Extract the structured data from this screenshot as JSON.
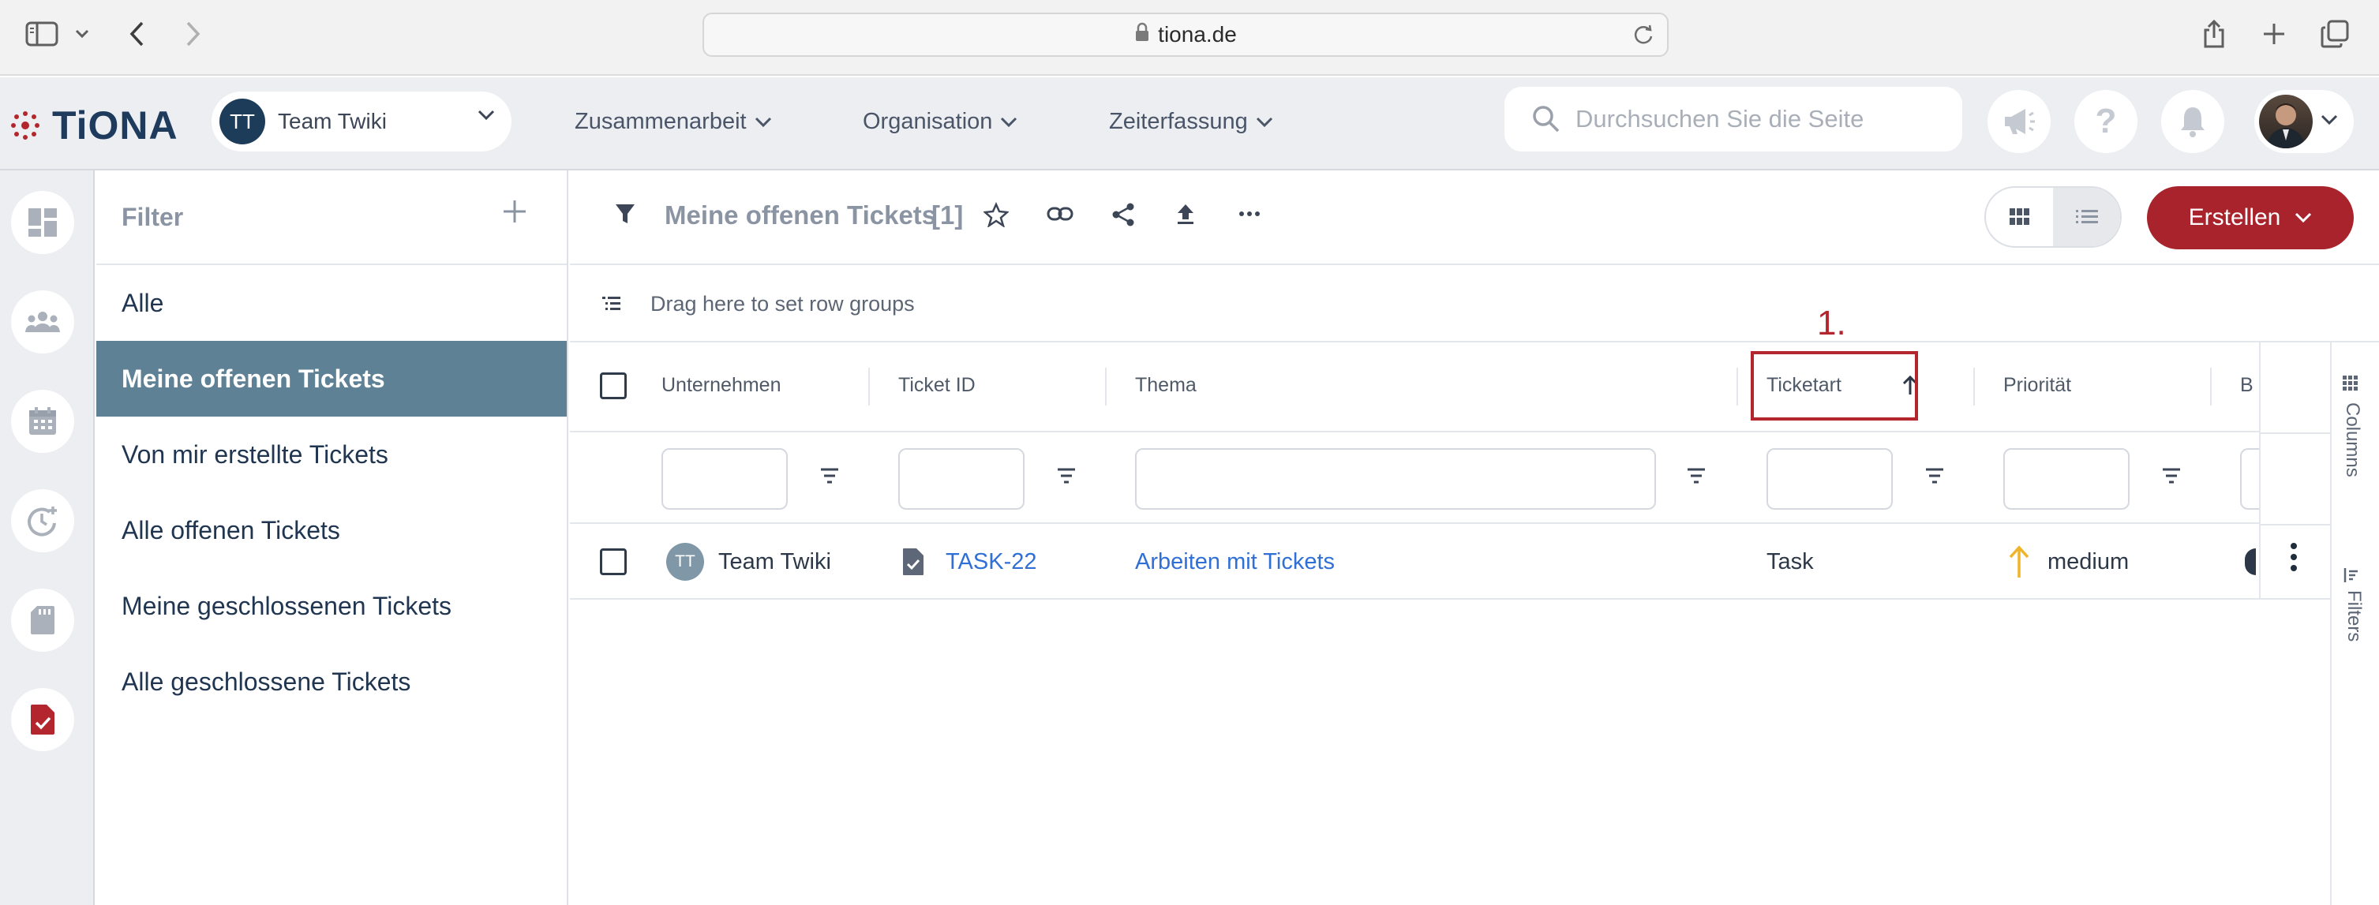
{
  "browser": {
    "url": "tiona.de"
  },
  "header": {
    "logo_text": "TiONA",
    "team": {
      "initials": "TT",
      "name": "Team Twiki"
    },
    "nav": [
      "Zusammenarbeit",
      "Organisation",
      "Zeiterfassung"
    ],
    "search_placeholder": "Durchsuchen Sie die Seite"
  },
  "filter_panel": {
    "title": "Filter",
    "items": [
      "Alle",
      "Meine offenen Tickets",
      "Von mir erstellte Tickets",
      "Alle offenen Tickets",
      "Meine geschlossenen Tickets",
      "Alle geschlossene Tickets"
    ],
    "active_index": 1
  },
  "toolbar": {
    "view_title": "Meine offenen Tickets",
    "count": "[1]",
    "create_label": "Erstellen"
  },
  "grid": {
    "group_hint": "Drag here to set row groups",
    "columns": [
      "Unternehmen",
      "Ticket ID",
      "Thema",
      "Ticketart",
      "Priorität",
      "B"
    ],
    "sorted_column": "Ticketart",
    "sort_direction": "ascending",
    "rows": [
      {
        "company_initials": "TT",
        "company": "Team Twiki",
        "ticket_id": "TASK-22",
        "topic": "Arbeiten mit Tickets",
        "ticket_type": "Task",
        "priority": "medium"
      }
    ],
    "side_panels": [
      "Columns",
      "Filters"
    ]
  },
  "annotation": {
    "step_label": "1.",
    "color": "#b3262e"
  },
  "colors": {
    "brand_red": "#a8232b",
    "active_filter_bg": "#5f8195",
    "link_blue": "#2f6fd6",
    "priority_medium": "#f0b429"
  }
}
